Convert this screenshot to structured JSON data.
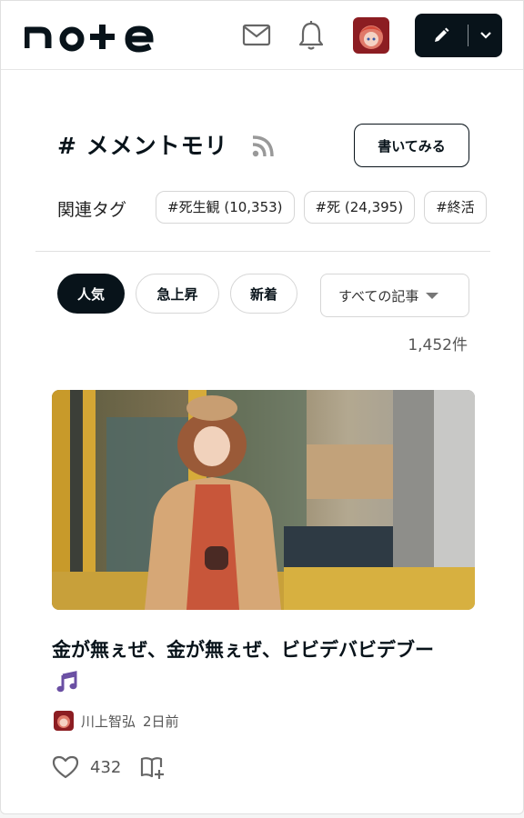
{
  "header": {
    "logo_text": "note",
    "mail_icon": "mail-icon",
    "bell_icon": "bell-icon",
    "post_icon": "pencil-icon",
    "menu_icon": "chevron-down-icon"
  },
  "tag": {
    "title": "# メメントモリ",
    "rss_icon": "rss-icon",
    "write_label": "書いてみる"
  },
  "related": {
    "label": "関連タグ",
    "tags": [
      "#死生観 (10,353)",
      "#死 (24,395)",
      "#終活"
    ]
  },
  "sort": {
    "options": [
      "人気",
      "急上昇",
      "新着"
    ],
    "active": "人気",
    "filter_label": "すべての記事",
    "count": "1,452件"
  },
  "article": {
    "title": "金が無ぇぜ、金が無ぇぜ、ビビデバビデブー",
    "title_icon": "music-note-icon",
    "author": "川上智弘",
    "time": "2日前",
    "likes": "432"
  },
  "colors": {
    "primary": "#08131a",
    "border": "#d6d6d6",
    "music_note": "#6a4fa3"
  }
}
